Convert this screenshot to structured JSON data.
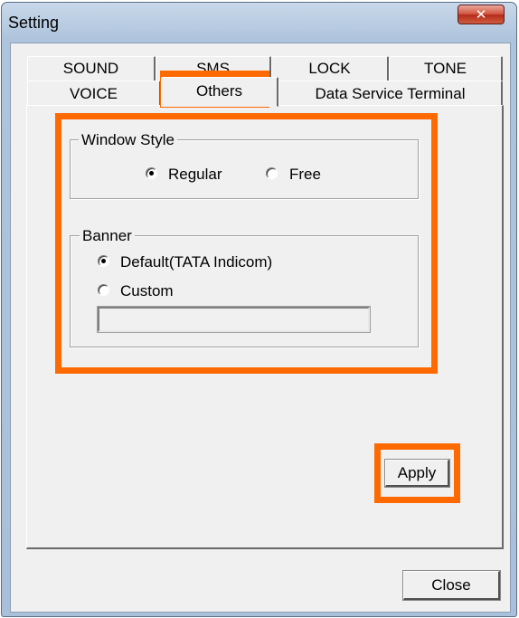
{
  "window": {
    "title": "Setting",
    "close_glyph": "✕"
  },
  "tabs": {
    "row1": [
      "SOUND",
      "SMS",
      "LOCK",
      "TONE"
    ],
    "row2": [
      "VOICE",
      "Others",
      "Data Service Terminal"
    ],
    "selected": "Others"
  },
  "window_style": {
    "legend": "Window Style",
    "options": [
      {
        "label": "Regular",
        "checked": true
      },
      {
        "label": "Free",
        "checked": false
      }
    ]
  },
  "banner": {
    "legend": "Banner",
    "options": [
      {
        "label": "Default(TATA Indicom)",
        "checked": true
      },
      {
        "label": "Custom",
        "checked": false
      }
    ],
    "custom_value": ""
  },
  "buttons": {
    "apply": "Apply",
    "close": "Close"
  },
  "highlight_color": "#ff6a00"
}
